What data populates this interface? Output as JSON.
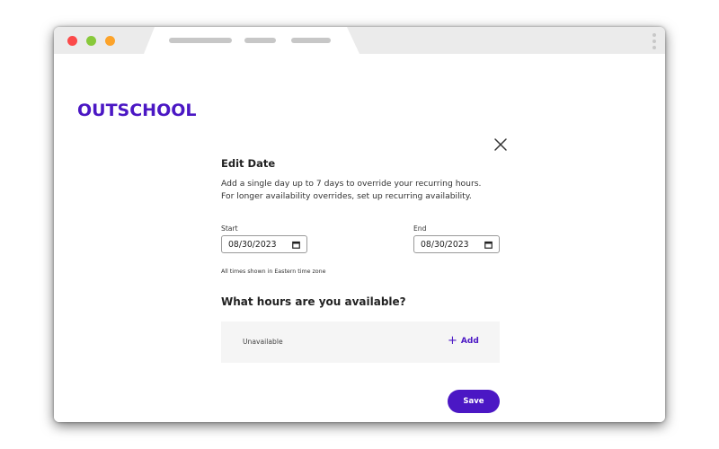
{
  "brand": {
    "logo_text": "OUTSCHOOL",
    "color": "#4b17c4"
  },
  "browser": {
    "dots": [
      "#fb4a4a",
      "#88c93b",
      "#fca32a"
    ],
    "menu_icon": "kebab-menu-icon"
  },
  "dialog": {
    "close_icon": "close-icon",
    "title": "Edit Date",
    "description_line1": "Add a single day up to 7 days to override your recurring hours.",
    "description_line2": "For longer availability overrides, set up recurring availability.",
    "start": {
      "label": "Start",
      "value": "08/30/2023"
    },
    "end": {
      "label": "End",
      "value": "08/30/2023"
    },
    "timezone_note": "All times shown in Eastern time zone",
    "hours_heading": "What hours are you available?",
    "availability": {
      "status": "Unavailable",
      "add_label": "Add"
    },
    "save_label": "Save"
  }
}
